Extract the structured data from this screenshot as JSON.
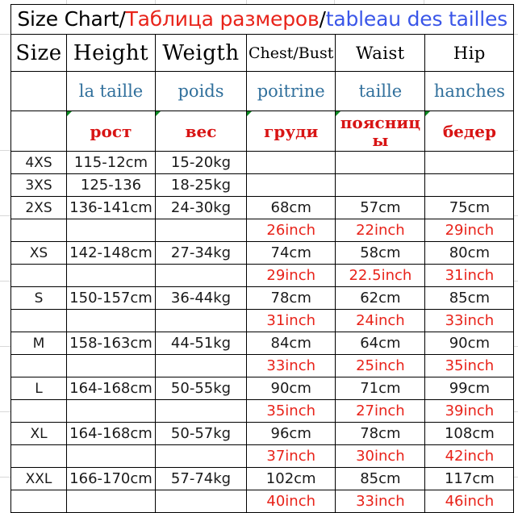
{
  "title": {
    "part_en": "Size Chart/",
    "part_ru": "Таблица размеров",
    "separator": "/",
    "part_fr": "tableau des tailles"
  },
  "colors": {
    "red": "#e8231a",
    "title_blue": "#3a56e8",
    "french_blue": "#31709c",
    "black": "#000000",
    "marker_green": "#0a8a22",
    "border": "#000000"
  },
  "headers": {
    "english": [
      "Size",
      "Height",
      "Weigth",
      "Chest/Bust",
      "Waist",
      "Hip"
    ],
    "french": [
      "",
      "la taille",
      "poids",
      "poitrine",
      "taille",
      "hanches"
    ],
    "russian": [
      "",
      "рост",
      "вес",
      "груди",
      "поясницы",
      "бедер"
    ]
  },
  "rows": [
    {
      "size": "4XS",
      "height": "115-12cm",
      "weight": "15-20kg",
      "chest_cm": "",
      "waist_cm": "",
      "hip_cm": "",
      "has_inch_row": false,
      "chest_in": "",
      "waist_in": "",
      "hip_in": ""
    },
    {
      "size": "3XS",
      "height": "125-136",
      "weight": "18-25kg",
      "chest_cm": "",
      "waist_cm": "",
      "hip_cm": "",
      "has_inch_row": false,
      "chest_in": "",
      "waist_in": "",
      "hip_in": ""
    },
    {
      "size": "2XS",
      "height": "136-141cm",
      "weight": "24-30kg",
      "chest_cm": "68cm",
      "waist_cm": "57cm",
      "hip_cm": "75cm",
      "has_inch_row": true,
      "chest_in": "26inch",
      "waist_in": "22inch",
      "hip_in": "29inch"
    },
    {
      "size": "XS",
      "height": "142-148cm",
      "weight": "27-34kg",
      "chest_cm": "74cm",
      "waist_cm": "58cm",
      "hip_cm": "80cm",
      "has_inch_row": true,
      "chest_in": "29inch",
      "waist_in": "22.5inch",
      "hip_in": "31inch"
    },
    {
      "size": "S",
      "height": "150-157cm",
      "weight": "36-44kg",
      "chest_cm": "78cm",
      "waist_cm": "62cm",
      "hip_cm": "85cm",
      "has_inch_row": true,
      "chest_in": "31inch",
      "waist_in": "24inch",
      "hip_in": "33inch"
    },
    {
      "size": "M",
      "height": "158-163cm",
      "weight": "44-51kg",
      "chest_cm": "84cm",
      "waist_cm": "64cm",
      "hip_cm": "90cm",
      "has_inch_row": true,
      "chest_in": "33inch",
      "waist_in": "25inch",
      "hip_in": "35inch"
    },
    {
      "size": "L",
      "height": "164-168cm",
      "weight": "50-55kg",
      "chest_cm": "90cm",
      "waist_cm": "71cm",
      "hip_cm": "99cm",
      "has_inch_row": true,
      "chest_in": "35inch",
      "waist_in": "27inch",
      "hip_in": "39inch"
    },
    {
      "size": "XL",
      "height": "164-168cm",
      "weight": "50-57kg",
      "chest_cm": "96cm",
      "waist_cm": "78cm",
      "hip_cm": "108cm",
      "has_inch_row": true,
      "chest_in": "37inch",
      "waist_in": "30inch",
      "hip_in": "42inch"
    },
    {
      "size": "XXL",
      "height": "166-170cm",
      "weight": "57-74kg",
      "chest_cm": "102cm",
      "waist_cm": "85cm",
      "hip_cm": "117cm",
      "has_inch_row": true,
      "chest_in": "40inch",
      "waist_in": "33inch",
      "hip_in": "46inch"
    }
  ]
}
